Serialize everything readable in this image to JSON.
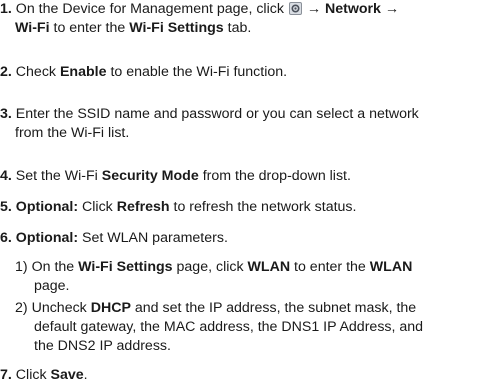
{
  "steps": {
    "s1": {
      "num": "1.",
      "a": "On the Device for Management page, click",
      "arrow1": "→",
      "network": "Network",
      "arrow2": "→",
      "wifi": "Wi-Fi",
      "b": "to enter the",
      "tab": "Wi-Fi Settings",
      "c": "tab.",
      "icon": "settings-gear-icon"
    },
    "s2": {
      "num": "2.",
      "a": "Check",
      "enable": "Enable",
      "b": "to enable the Wi-Fi function."
    },
    "s3": {
      "num": "3.",
      "l1": "Enter the SSID name and password or you can select a network",
      "l2": "from the Wi-Fi list."
    },
    "s4": {
      "num": "4.",
      "a": "Set the Wi-Fi",
      "mode": "Security Mode",
      "b": "from the drop-down list."
    },
    "s5": {
      "num": "5.",
      "opt": "Optional:",
      "a": "Click",
      "refresh": "Refresh",
      "b": "to refresh the network status."
    },
    "s6": {
      "num": "6.",
      "opt": "Optional:",
      "a": "Set WLAN parameters.",
      "sub1": {
        "num": "1)",
        "a": "On the",
        "page": "Wi-Fi Settings",
        "b": "page, click",
        "wlan": "WLAN",
        "c": "to enter the",
        "wlan2": "WLAN",
        "l2": "page."
      },
      "sub2": {
        "num": "2)",
        "a": "Uncheck",
        "dhcp": "DHCP",
        "b": "and set the IP address, the subnet mask, the",
        "l2": "default gateway, the MAC address, the DNS1 IP Address, and",
        "l3": "the DNS2 IP address."
      }
    },
    "s7": {
      "num": "7.",
      "a": "Click",
      "save": "Save",
      "b": "."
    }
  }
}
